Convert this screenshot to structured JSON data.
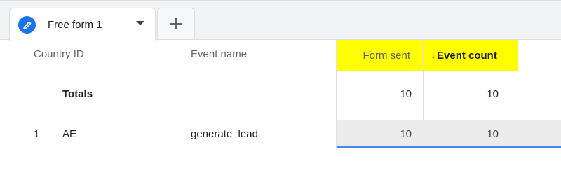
{
  "tabs": {
    "active_label": "Free form 1",
    "add_symbol": "+"
  },
  "table": {
    "columns": {
      "country_id": "Country ID",
      "event_name": "Event name",
      "form_sent": "Form sent",
      "event_count": "Event count",
      "sort_arrow": "↓"
    },
    "highlight_color": "#ffff00",
    "totals": {
      "label": "Totals",
      "form_sent": "10",
      "event_count": "10"
    },
    "rows": [
      {
        "index": "1",
        "country_id": "AE",
        "event_name": "generate_lead",
        "form_sent": "10",
        "event_count": "10"
      }
    ]
  },
  "colors": {
    "accent": "#1a73e8"
  }
}
